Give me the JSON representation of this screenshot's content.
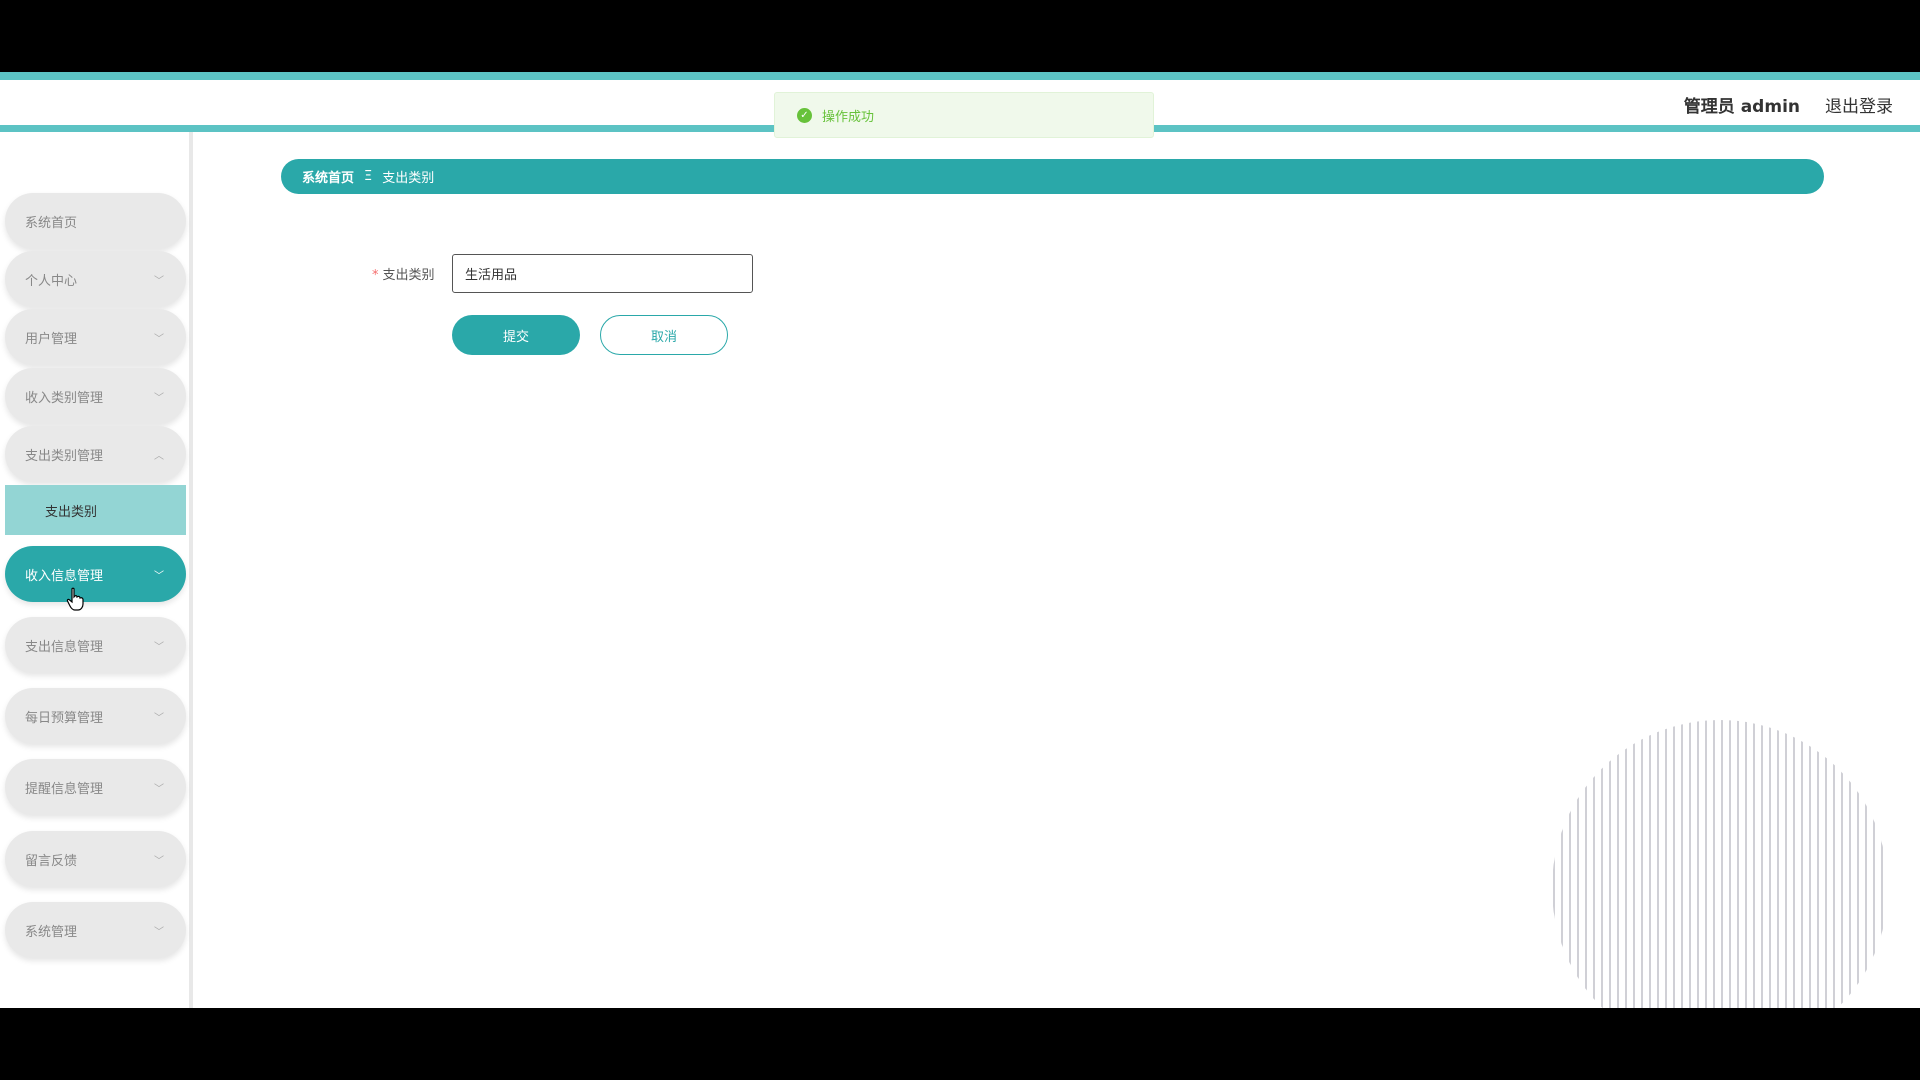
{
  "header": {
    "user_label": "管理员 admin",
    "logout_label": "退出登录"
  },
  "toast": {
    "message": "操作成功",
    "type": "success"
  },
  "sidebar": {
    "items": [
      {
        "label": "系统首页",
        "has_chevron": false
      },
      {
        "label": "个人中心",
        "has_chevron": true
      },
      {
        "label": "用户管理",
        "has_chevron": true
      },
      {
        "label": "收入类别管理",
        "has_chevron": true
      },
      {
        "label": "支出类别管理",
        "has_chevron": true,
        "expanded": true
      },
      {
        "label": "收入信息管理",
        "has_chevron": true,
        "hovered": true
      },
      {
        "label": "支出信息管理",
        "has_chevron": true
      },
      {
        "label": "每日预算管理",
        "has_chevron": true
      },
      {
        "label": "提醒信息管理",
        "has_chevron": true
      },
      {
        "label": "留言反馈",
        "has_chevron": true
      },
      {
        "label": "系统管理",
        "has_chevron": true
      }
    ],
    "sub_item": {
      "label": "支出类别"
    }
  },
  "breadcrumb": {
    "home": "系统首页",
    "separator": "Ξ",
    "current": "支出类别"
  },
  "form": {
    "field_label": "支出类别",
    "required_mark": "*",
    "field_value": "生活用品",
    "submit_label": "提交",
    "cancel_label": "取消"
  },
  "colors": {
    "accent": "#2aa8a9",
    "header_line": "#5cc3c4",
    "sub_item_bg": "#93d5d4",
    "success": "#67c23a"
  }
}
